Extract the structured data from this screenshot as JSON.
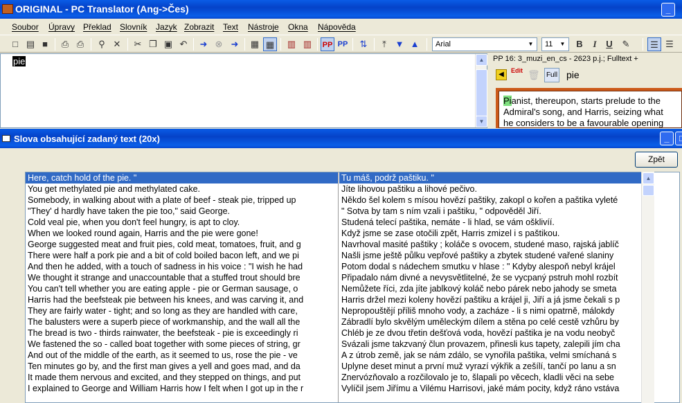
{
  "app": {
    "title": "ORIGINAL - PC Translator (Ang->Čes)"
  },
  "menu": [
    "Soubor",
    "Úpravy",
    "Překlad",
    "Slovník",
    "Jazyk",
    "Zobrazit",
    "Text",
    "Nástroje",
    "Okna",
    "Nápověda"
  ],
  "toolbar": {
    "font": "Arial",
    "size": "11",
    "bold": "B",
    "italic": "I",
    "underline": "U"
  },
  "editor": {
    "text": "pie"
  },
  "side": {
    "header": "PP 16: 3_muzi_en_cs - 2623 p.j.; Fulltext +",
    "full": "Full",
    "edit": "Edit",
    "search": "pie",
    "preview": [
      "Pianist, thereupon, starts prelude to the",
      "Admiral's song, and Harris, seizing what",
      "he considers to be a favourable opening"
    ],
    "preview_hl": "Pi",
    "preview_first_rest": "anist, thereupon, starts prelude to the"
  },
  "dialog": {
    "title": "Slova obsahující zadaný text (20x)",
    "back": "Zpět",
    "left": [
      "Here, catch hold of the pie. \"",
      "You get methylated pie and methylated cake.",
      "Somebody, in walking about with a plate of beef - steak pie, tripped up",
      "\"They' d hardly have taken the pie too,\" said George.",
      "Cold veal pie, when you don't feel hungry, is apt to cloy.",
      "When we looked round again, Harris and the pie were gone!",
      "George suggested meat and fruit pies, cold meat, tomatoes, fruit, and g",
      "There were half a pork pie and a bit of cold boiled bacon left, and we pi",
      "And then he added, with a touch of sadness in his voice : \"I wish he had",
      "We thought it strange and unaccountable that a stuffed trout should bre",
      "You can't tell whether you are eating apple - pie or German sausage, o",
      "Harris had the beefsteak pie between his knees, and was carving it, and",
      "They are fairly water - tight; and so long as they are handled with care,",
      "The balusters were a superb piece of workmanship, and the wall all the",
      "The bread is two - thirds rainwater, the beefsteak - pie is exceedingly ri",
      "We fastened the so - called boat together with some pieces of string, gr",
      "And out of the middle of the earth, as it seemed to us, rose the pie - ve",
      "Ten minutes go by, and the first man gives a yell and goes mad, and da",
      "It made them nervous and excited, and they stepped on things, and put",
      "I explained to George and William Harris how I felt when I got up in the r"
    ],
    "right": [
      "Tu máš, podrž paštiku. \"",
      "Jíte lihovou paštiku a lihové pečivo.",
      "Někdo šel kolem s mísou hovězí paštiky, zakopl o kořen a paštika vyleté",
      "\" Sotva by tam s ním vzali i paštiku, \" odpověděl Jiří.",
      "Studená telecí paštika, nemáte - li hlad, se vám ošklivíí.",
      "Když jsme se zase otočili zpět, Harris zmizel i s paštikou.",
      "Navrhoval masité paštiky ; koláče s ovocem, studené maso, rajská jablíč",
      "Našli jsme ještě půlku vepřové paštiky a zbytek studené vařené slaniny",
      "Potom dodal s nádechem smutku v hlase : \" Kdyby alespoň nebyl krájel",
      "Připadalo nám divné a nevysvětlitelné, že se vycpaný pstruh mohl rozbít",
      "Nemůžete říci, zda jíte jablkový koláč nebo párek nebo jahody se smeta",
      "Harris držel mezi koleny hovězí paštiku a krájel ji, Jiří a já jsme čekali s p",
      "Nepropouštějí příliš mnoho vody, a zacháze - li s nimi opatrně, málokdy",
      "Zábradlí bylo skvělým uměleckým dílem a stěna po celé cestě vzhůru by",
      "Chléb je ze dvou třetin dešťová voda, hovězí paštika je na vodu neobyč",
      "Svázali jsme takzvaný člun provazem, přinesli kus tapety, zalepili jím cha",
      "A z útrob země, jak se nám zdálo, se vynořila paštika, velmi smíchaná s",
      "Uplyne deset minut a první muž vyrazí výkřik a zešílí, tančí po lanu a sn",
      "Znervózňovalo a rozčilovalo je to, šlapali po věcech, kladli věci na sebe",
      "Vylíčil jsem Jiřímu a Vilému Harrisovi, jaké mám pocity, když ráno vstáva"
    ]
  }
}
